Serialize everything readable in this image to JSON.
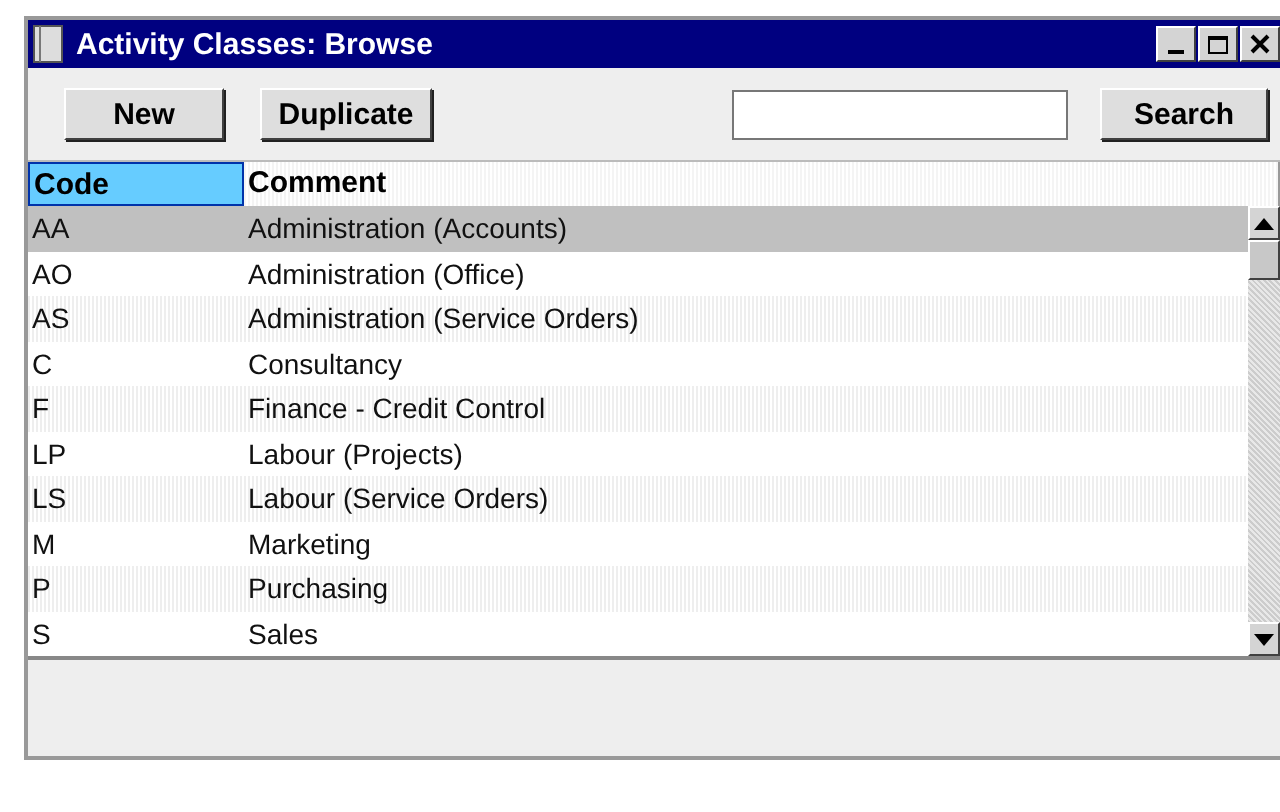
{
  "window": {
    "title": "Activity Classes: Browse"
  },
  "toolbar": {
    "buttons": [
      "New",
      "Duplicate"
    ],
    "search_button": "Search"
  },
  "table": {
    "columns": [
      {
        "label": "Code",
        "selected": true
      },
      {
        "label": "Comment",
        "selected": false
      }
    ],
    "rows": [
      {
        "code": "AA",
        "comment": "Administration (Accounts)",
        "selected": true
      },
      {
        "code": "AO",
        "comment": "Administration (Office)",
        "selected": false
      },
      {
        "code": "AS",
        "comment": "Administration (Service Orders)",
        "selected": false
      },
      {
        "code": "C",
        "comment": "Consultancy",
        "selected": false
      },
      {
        "code": "F",
        "comment": "Finance - Credit  Control",
        "selected": false
      },
      {
        "code": "LP",
        "comment": "Labour (Projects)",
        "selected": false
      },
      {
        "code": "LS",
        "comment": "Labour (Service Orders)",
        "selected": false
      },
      {
        "code": "M",
        "comment": "Marketing",
        "selected": false
      },
      {
        "code": "P",
        "comment": "Purchasing",
        "selected": false
      },
      {
        "code": "S",
        "comment": "Sales",
        "selected": false
      }
    ]
  }
}
